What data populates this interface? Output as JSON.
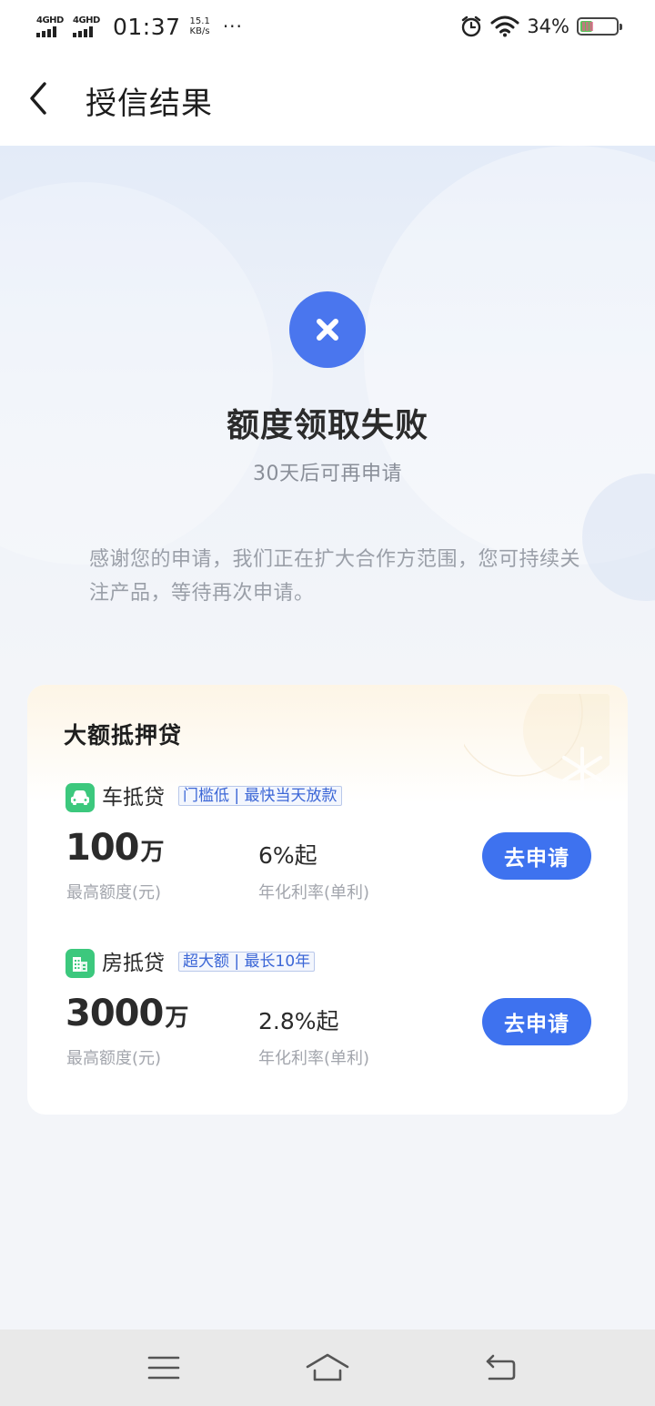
{
  "status_bar": {
    "network_1": "4GHD",
    "network_2": "4GHD",
    "time": "01:37",
    "speed_value": "15.1",
    "speed_unit": "KB/s",
    "more": "···",
    "battery_percent": "34%",
    "battery_level": 0.34
  },
  "nav": {
    "title": "授信结果"
  },
  "result": {
    "title": "额度领取失败",
    "subtitle": "30天后可再申请",
    "description": "感谢您的申请，我们正在扩大合作方范围，您可持续关注产品，等待再次申请。",
    "icon_color": "#4a76ee"
  },
  "card": {
    "title": "大额抵押贷",
    "loans": [
      {
        "name": "车抵贷",
        "tag": "门槛低 | 最快当天放款",
        "amount_num": "100",
        "amount_unit": "万",
        "amount_label": "最高额度(元)",
        "rate": "6%起",
        "rate_label": "年化利率(单利)",
        "button": "去申请"
      },
      {
        "name": "房抵贷",
        "tag": "超大额 | 最长10年",
        "amount_num": "3000",
        "amount_unit": "万",
        "amount_label": "最高额度(元)",
        "rate": "2.8%起",
        "rate_label": "年化利率(单利)",
        "button": "去申请"
      }
    ]
  },
  "colors": {
    "accent": "#3e72ef",
    "loan_icon": "#3cc87d"
  }
}
